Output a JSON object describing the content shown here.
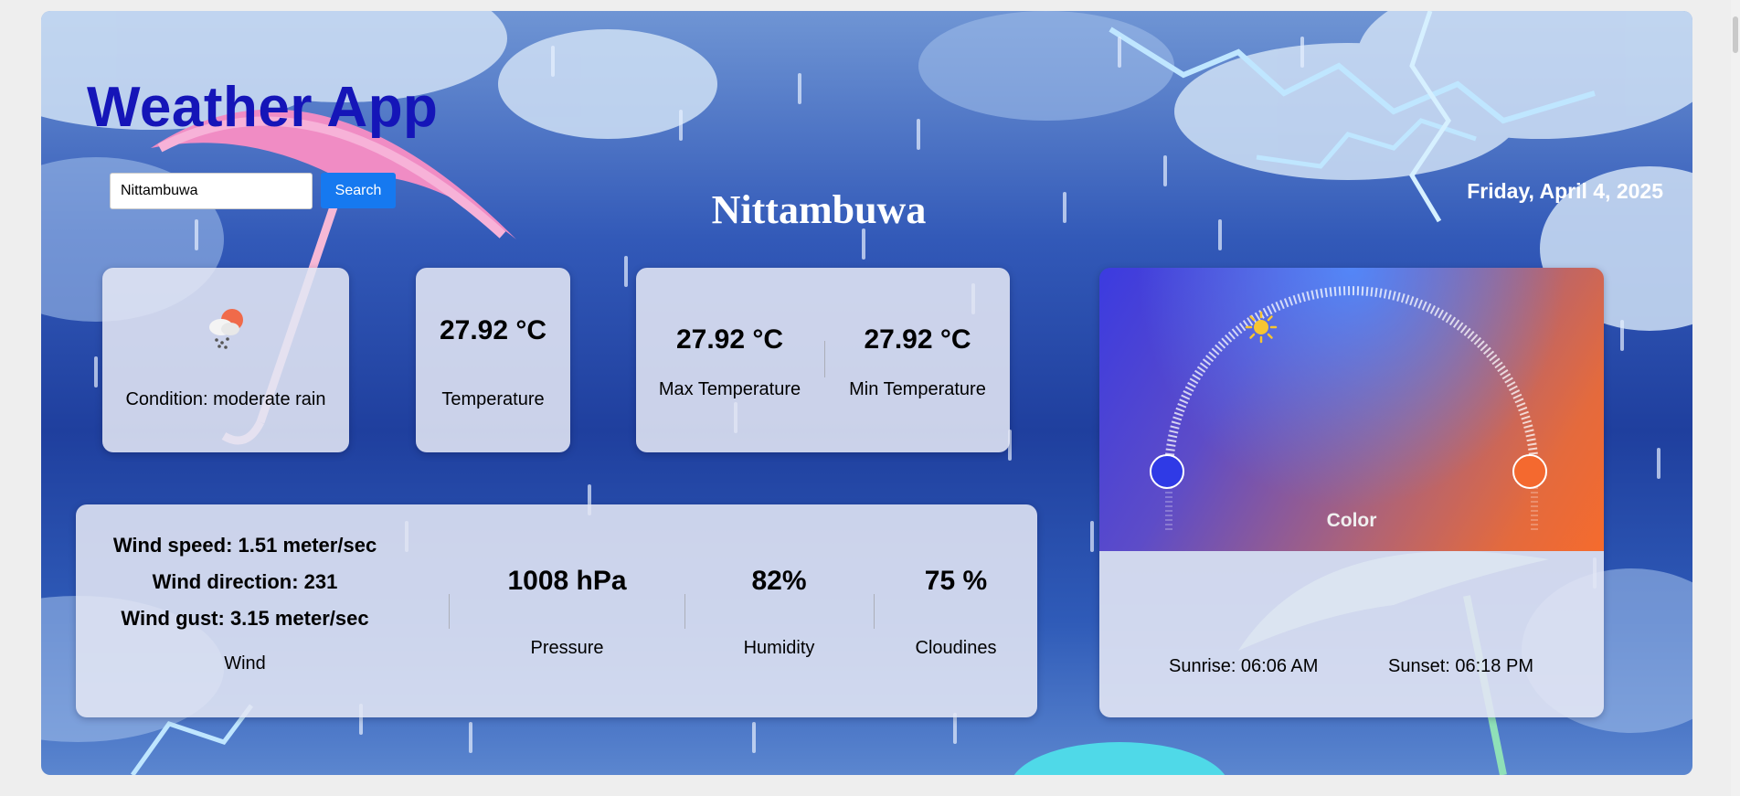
{
  "app": {
    "title": "Weather App"
  },
  "search": {
    "value": "Nittambuwa",
    "button_label": "Search"
  },
  "location": {
    "city": "Nittambuwa",
    "date": "Friday, April 4, 2025"
  },
  "condition": {
    "icon": "rain-cloud-sun-icon",
    "label": "Condition: moderate rain"
  },
  "temperature": {
    "value": "27.92 °C",
    "label": "Temperature"
  },
  "range": {
    "max_value": "27.92 °C",
    "max_label": "Max Temperature",
    "min_value": "27.92 °C",
    "min_label": "Min Temperature"
  },
  "wind": {
    "speed": "Wind speed: 1.51 meter/sec",
    "direction": "Wind direction: 231",
    "gust": "Wind gust: 3.15 meter/sec",
    "label": "Wind"
  },
  "pressure": {
    "value": "1008 hPa",
    "label": "Pressure"
  },
  "humidity": {
    "value": "82%",
    "label": "Humidity"
  },
  "cloudiness": {
    "value": "75 %",
    "label": "Cloudines"
  },
  "sun": {
    "color_label": "Color",
    "sunrise": "Sunrise: 06:06 AM",
    "sunset": "Sunset: 06:18 PM",
    "colors": {
      "sunrise_marker": "#2f3ae6",
      "sunset_marker": "#f4692f",
      "sun": "#f7c531"
    }
  }
}
